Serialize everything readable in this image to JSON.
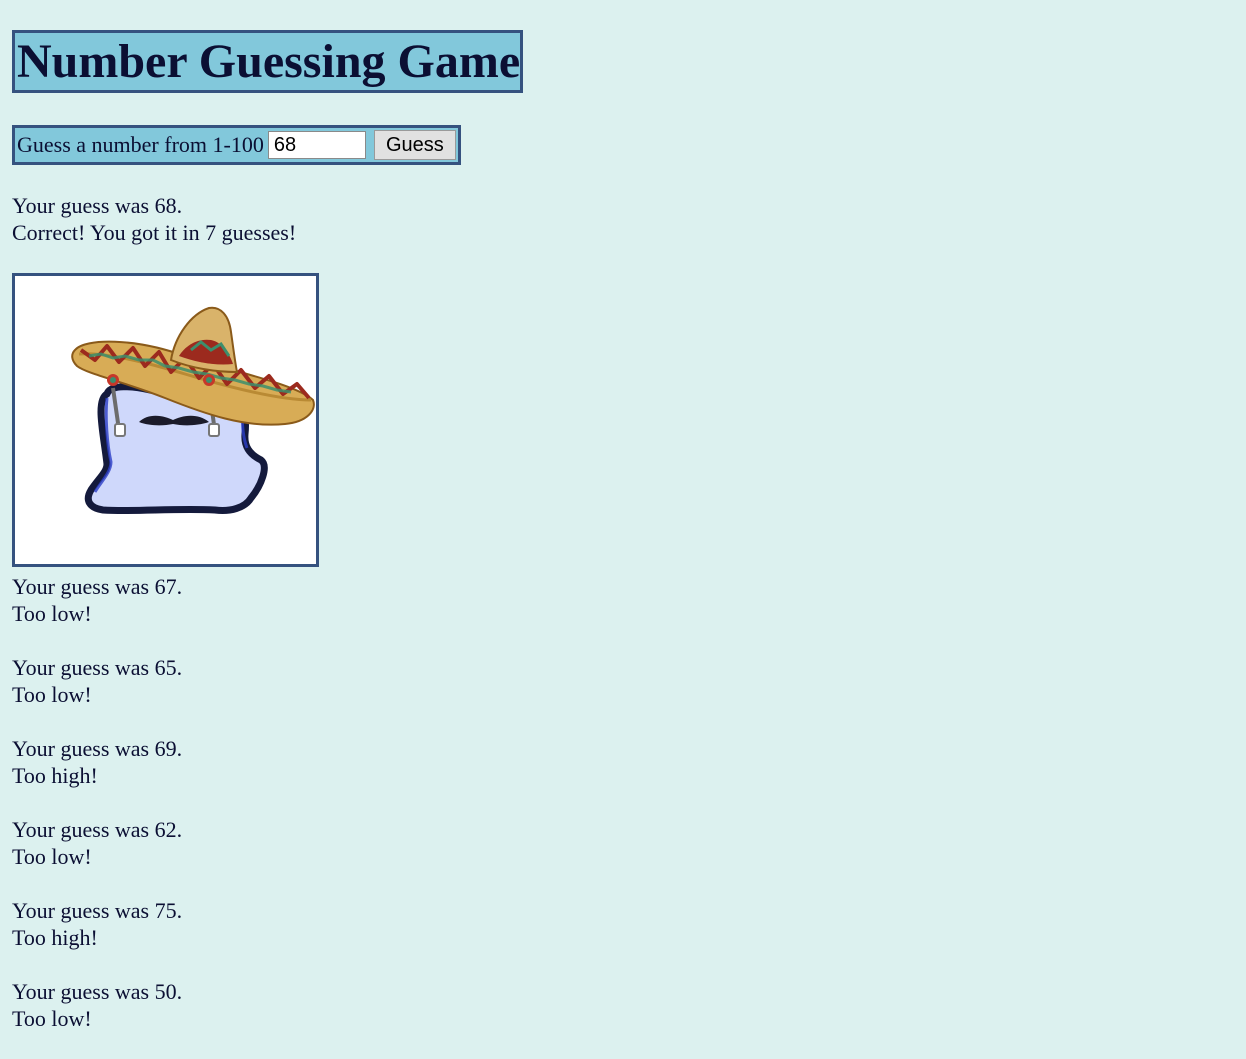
{
  "header": {
    "title": "Number Guessing Game"
  },
  "form": {
    "label": "Guess a number from 1-100",
    "input_value": "68",
    "button_label": "Guess"
  },
  "result": {
    "guess_line": "Your guess was 68.",
    "message": "Correct! You got it in 7 guesses!"
  },
  "picture": {
    "icon": "sombrero-ghost-icon"
  },
  "history": [
    {
      "guess_line": "Your guess was 67.",
      "message": "Too low!"
    },
    {
      "guess_line": "Your guess was 65.",
      "message": "Too low!"
    },
    {
      "guess_line": "Your guess was 69.",
      "message": "Too high!"
    },
    {
      "guess_line": "Your guess was 62.",
      "message": "Too low!"
    },
    {
      "guess_line": "Your guess was 75.",
      "message": "Too high!"
    },
    {
      "guess_line": "Your guess was 50.",
      "message": "Too low!"
    }
  ],
  "colors": {
    "background": "#dcf1ef",
    "panel": "#82c8db",
    "border": "#35527f",
    "text": "#0b0f33"
  }
}
